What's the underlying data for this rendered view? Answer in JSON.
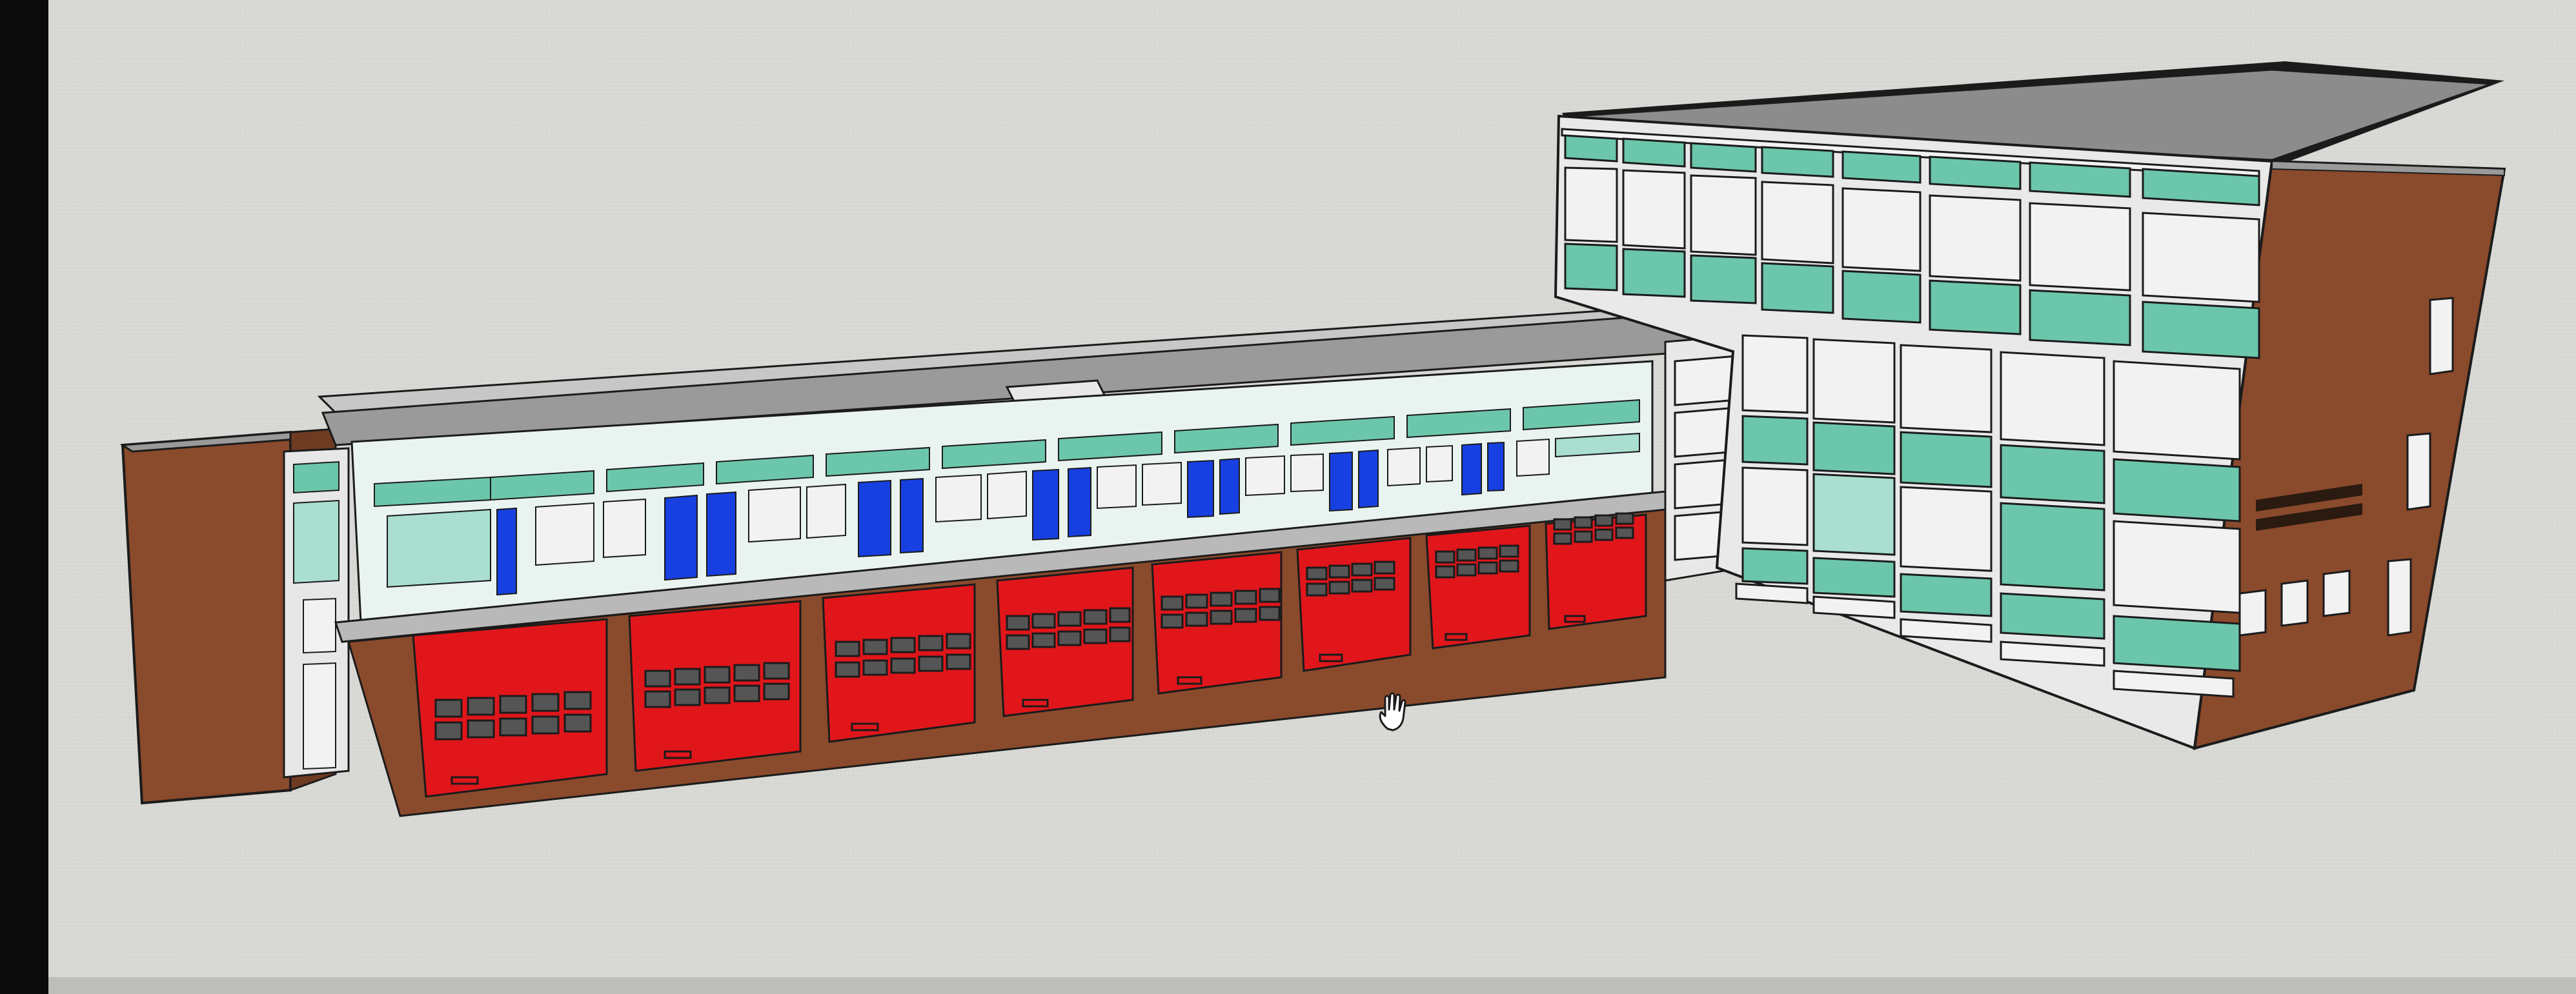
{
  "screen": {
    "background_color": "#d9d9d6",
    "bezel_color": "#0b0b0b"
  },
  "model": {
    "colors": {
      "brick": "#8a4a2c",
      "brick_dark": "#6e3a22",
      "roof": "#8c8c8c",
      "roof_light": "#b9b9b9",
      "glass_teal": "#6cc6ac",
      "glass_light": "#a9ded0",
      "door_blue": "#1740e0",
      "garage_red": "#e0161b",
      "frame_white": "#f2f2f2",
      "outline": "#1b1b1b"
    },
    "garage_door_count": 8,
    "tower_floor_count": 4,
    "sign_text": ""
  },
  "cursor": {
    "icon": "hand-pan-icon"
  }
}
